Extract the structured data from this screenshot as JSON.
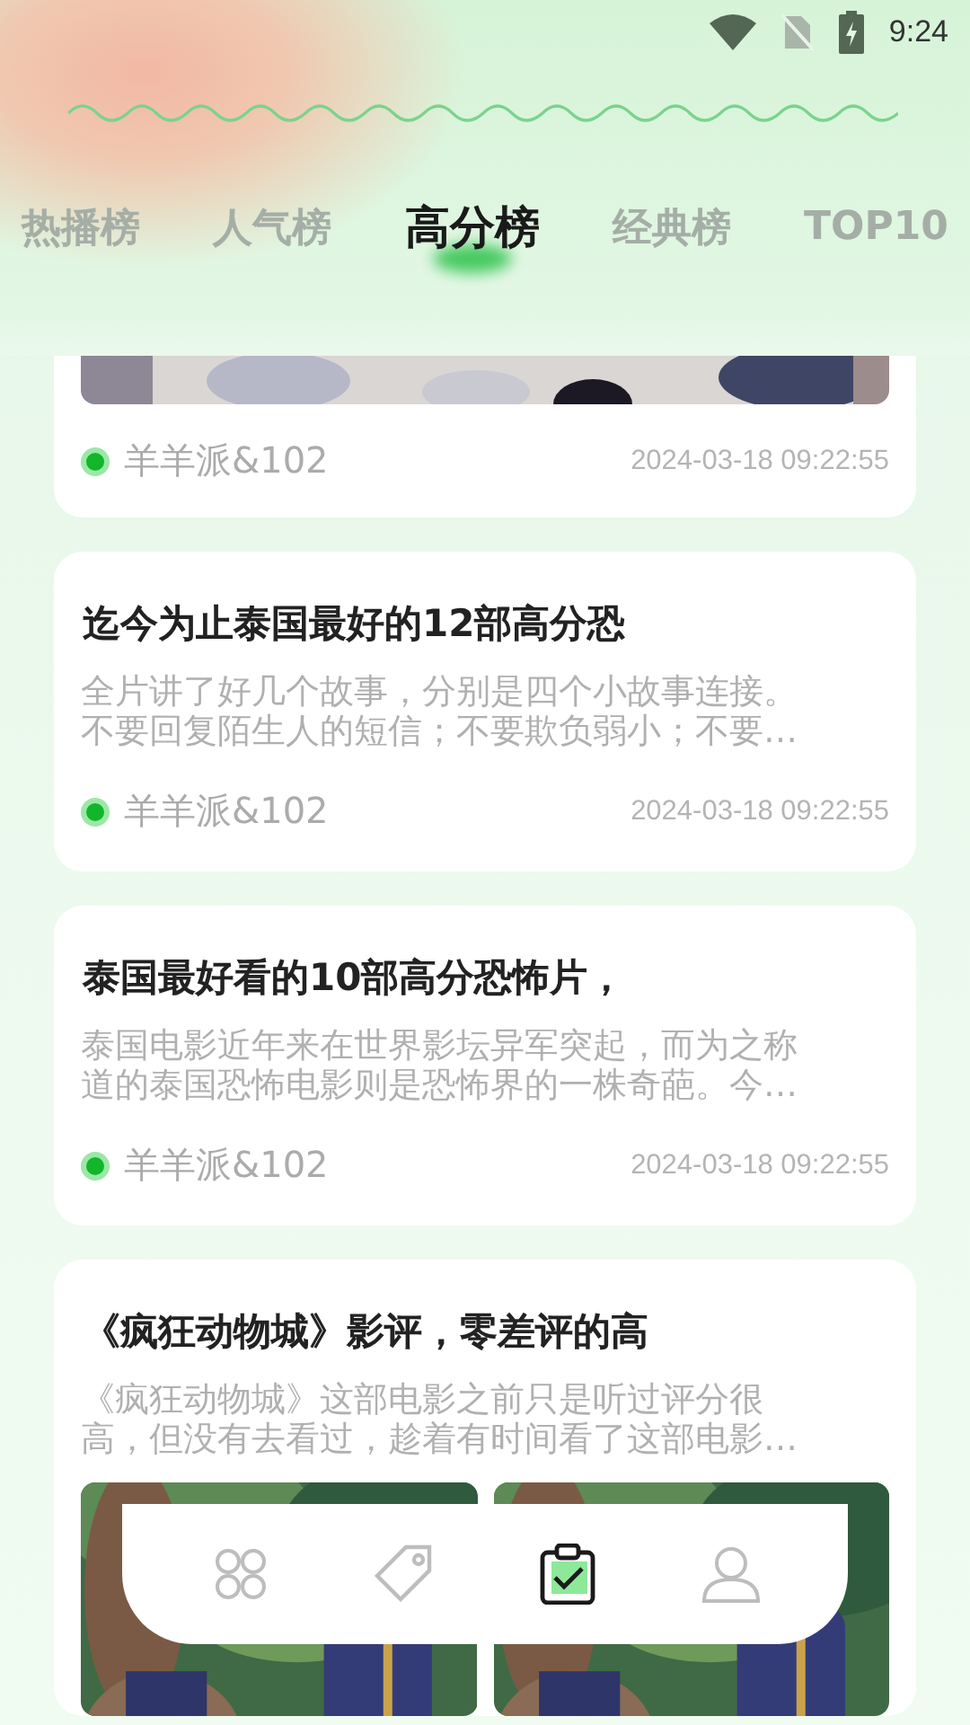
{
  "status_bar": {
    "time": "9:24"
  },
  "tabs": [
    {
      "label": "热播榜",
      "selected": false
    },
    {
      "label": "人气榜",
      "selected": false
    },
    {
      "label": "高分榜",
      "selected": true
    },
    {
      "label": "经典榜",
      "selected": false
    },
    {
      "label": "TOP10",
      "selected": false
    }
  ],
  "articles": [
    {
      "kind": "partial",
      "author": "羊羊派&102",
      "online": true,
      "date": "2024-03-18 09:22:55"
    },
    {
      "kind": "text",
      "title": "迄今为止泰国最好的12部高分恐",
      "summary_lines": [
        "全片讲了好几个故事，分别是四个小故事连接。",
        "不要回复陌生人的短信；不要欺负弱小；不要…"
      ],
      "author": "羊羊派&102",
      "online": true,
      "date": "2024-03-18 09:22:55"
    },
    {
      "kind": "text",
      "title": "泰国最好看的10部高分恐怖片，",
      "summary_lines": [
        "泰国电影近年来在世界影坛异军突起，而为之称",
        "道的泰国恐怖电影则是恐怖界的一株奇葩。今…"
      ],
      "author": "羊羊派&102",
      "online": true,
      "date": "2024-03-18 09:22:55"
    },
    {
      "kind": "images",
      "title": "《疯狂动物城》影评，零差评的高",
      "summary_lines": [
        "《疯狂动物城》这部电影之前只是听过评分很",
        "高，但没有去看过，趁着有时间看了这部电影…"
      ]
    }
  ],
  "nav": {
    "items": [
      {
        "kind": "apps",
        "selected": false
      },
      {
        "kind": "tag",
        "selected": false
      },
      {
        "kind": "clipboard",
        "selected": true
      },
      {
        "kind": "user",
        "selected": false
      }
    ]
  }
}
